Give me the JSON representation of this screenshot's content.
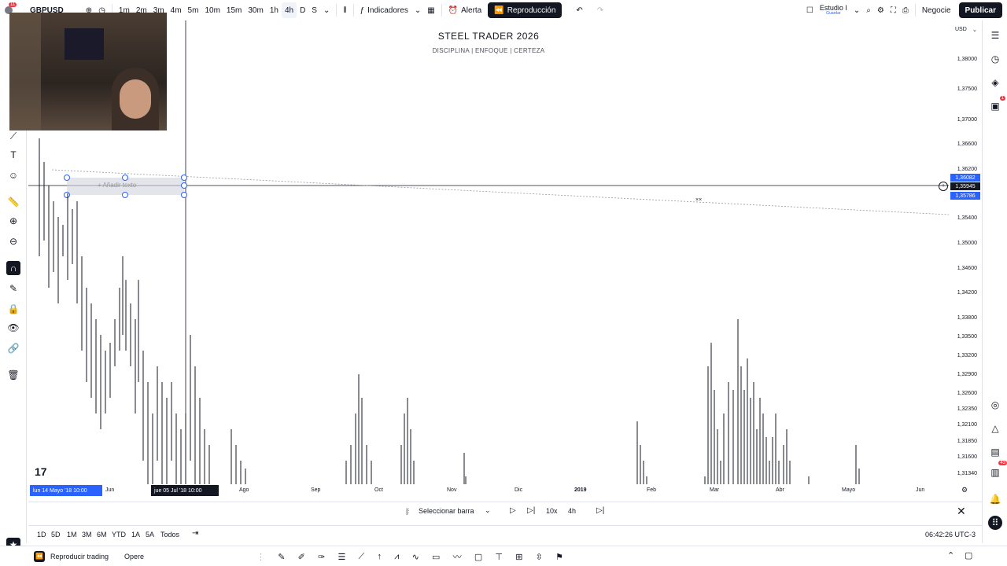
{
  "topbar": {
    "symbol": "GBPUSD",
    "timeframes": [
      "1m",
      "2m",
      "3m",
      "4m",
      "5m",
      "10m",
      "15m",
      "30m",
      "1h",
      "4h",
      "D",
      "S"
    ],
    "active_timeframe": "4h",
    "indicators": "Indicadores",
    "alert": "Alerta",
    "replay": "Reproducción",
    "layout_name": "Estudio I",
    "layout_saved": "Guardar",
    "trade": "Negocie",
    "publish": "Publicar"
  },
  "chart": {
    "title": "STEEL TRADER 2026",
    "subtitle": "DISCIPLINA   |   ENFOQUE   |   CERTEZA",
    "currency": "USD",
    "text_placeholder": "+ Añadir texto"
  },
  "price_scale": [
    "1,38000",
    "1,37500",
    "1,37000",
    "1,36600",
    "1,36200",
    "1,35400",
    "1,35000",
    "1,34600",
    "1,34200",
    "1,33800",
    "1,33500",
    "1,33200",
    "1,32900",
    "1,32600",
    "1,32350",
    "1,32100",
    "1,31850",
    "1,31600",
    "1,31340"
  ],
  "price_highlights": [
    "1,36082",
    "1,35945",
    "1,35786"
  ],
  "time_axis": {
    "start_label": "lun 14 Mayo '18   10:00",
    "cursor_label": "jue 05 Jul '18   10:00",
    "labels": [
      "Jun",
      "Ago",
      "Sep",
      "Oct",
      "Nov",
      "Dic",
      "2019",
      "Feb",
      "Mar",
      "Abr",
      "Mayo",
      "Jun"
    ]
  },
  "replay_bar": {
    "select_bar": "Seleccionar barra",
    "speed": "10x",
    "interval": "4h"
  },
  "range_bar": {
    "ranges": [
      "1D",
      "5D",
      "1M",
      "3M",
      "6M",
      "YTD",
      "1A",
      "5A",
      "Todos"
    ],
    "clock": "06:42:26 UTC-3"
  },
  "bottom_bar": {
    "replay_trading": "Reproducir trading",
    "trade": "Opere"
  },
  "badges": {
    "notifications": "11",
    "alerts_right": "1",
    "chat_count": "43"
  }
}
